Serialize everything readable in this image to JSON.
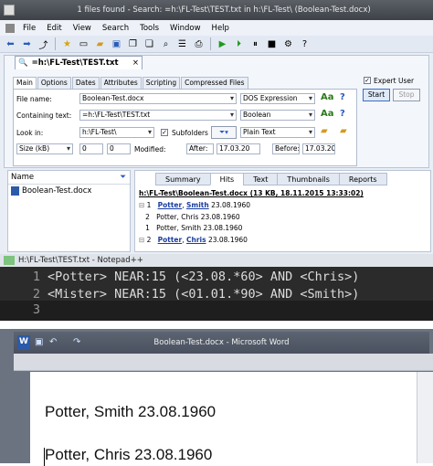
{
  "filelocator": {
    "title": "1 files found - Search: =h:\\FL-Test\\TEST.txt in h:\\FL-Test\\ (Boolean-Test.docx)",
    "menu": [
      "File",
      "Edit",
      "View",
      "Search",
      "Tools",
      "Window",
      "Help"
    ],
    "search_tab_label": "=h:\\FL-Test\\TEST.txt",
    "tabs": [
      "Main",
      "Options",
      "Dates",
      "Attributes",
      "Scripting",
      "Compressed Files"
    ],
    "file_name_label": "File name:",
    "file_name_value": "Boolean-Test.docx",
    "file_name_mode": "DOS Expression",
    "containing_text_label": "Containing text:",
    "containing_text_value": "=h:\\FL-Test\\TEST.txt",
    "containing_text_mode": "Boolean",
    "look_in_label": "Look in:",
    "look_in_value": "h:\\FL-Test\\",
    "subfolders_label": "Subfolders",
    "text_mode": "Plain Text",
    "size_unit": "Size (kB)",
    "size_from": "0",
    "size_to": "0",
    "modified_label": "Modified:",
    "after_label": "After:",
    "after_value": "17.03.20",
    "before_label": "Before:",
    "before_value": "17.03.20",
    "expert_user_label": "Expert User",
    "start_label": "Start",
    "stop_label": "Stop",
    "list_header": "Name",
    "list_item": "Boolean-Test.docx",
    "result_tabs": [
      "Summary",
      "Hits",
      "Text",
      "Thumbnails",
      "Reports"
    ],
    "result_header": "h:\\FL-Test\\Boolean-Test.docx   (13 KB,  18.11.2015 13:33:02)",
    "hits": [
      {
        "num": "1",
        "pre": "",
        "a1": "Potter",
        "mid": ", ",
        "a2": "Smith",
        "post": " 23.08.1960"
      },
      {
        "num": "2",
        "pre": "Potter, Chris 23.08.1960",
        "a1": "",
        "mid": "",
        "a2": "",
        "post": ""
      },
      {
        "num": "1",
        "pre": "Potter, Smith 23.08.1960",
        "a1": "",
        "mid": "",
        "a2": "",
        "post": ""
      },
      {
        "num": "2",
        "pre": "",
        "a1": "Potter",
        "mid": ", ",
        "a2": "Chris",
        "post": " 23.08.1960"
      }
    ]
  },
  "notepad": {
    "title": "H:\\FL-Test\\TEST.txt - Notepad++",
    "lines": [
      {
        "num": "1",
        "text": "<Potter> NEAR:15 (<23.08.*60> AND <Chris>)"
      },
      {
        "num": "2",
        "text": "<Mister> NEAR:15 (<01.01.*90> AND <Smith>)"
      },
      {
        "num": "3",
        "text": ""
      }
    ]
  },
  "word": {
    "title": "Boolean-Test.docx - Microsoft Word",
    "icon_letter": "W",
    "lines": [
      "Potter, Smith 23.08.1960",
      "Potter, Chris 23.08.1960"
    ]
  }
}
